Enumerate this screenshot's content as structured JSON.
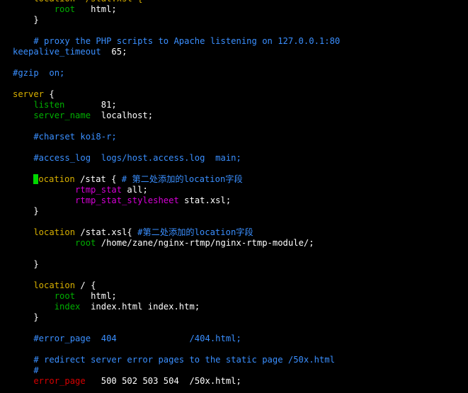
{
  "terminal": {
    "background": "#000000",
    "default_color": "#ffffff",
    "cursor_color": "#00d700",
    "lines": [
      {
        "segments": [
          {
            "text": "    location  /stat.xsl {",
            "color": "#d7af00"
          }
        ]
      },
      {
        "segments": [
          {
            "text": "        root",
            "color": "#00af00"
          },
          {
            "text": "   html;",
            "color": "#ffffff"
          }
        ]
      },
      {
        "segments": [
          {
            "text": "    }",
            "color": "#ffffff"
          }
        ]
      },
      {
        "segments": []
      },
      {
        "segments": [
          {
            "text": "    # proxy the PHP scripts to Apache listening on 127.0.0.1:80",
            "color": "#3a8fff"
          }
        ]
      },
      {
        "segments": [
          {
            "text": "keepalive_timeout",
            "color": "#3a8fff"
          },
          {
            "text": "  65;",
            "color": "#ffffff"
          }
        ]
      },
      {
        "segments": []
      },
      {
        "segments": [
          {
            "text": "#gzip  on;",
            "color": "#3a8fff"
          }
        ]
      },
      {
        "segments": []
      },
      {
        "segments": [
          {
            "text": "server",
            "color": "#d7af00"
          },
          {
            "text": " {",
            "color": "#ffffff"
          }
        ]
      },
      {
        "segments": [
          {
            "text": "    listen",
            "color": "#00af00"
          },
          {
            "text": "       81;",
            "color": "#ffffff"
          }
        ]
      },
      {
        "segments": [
          {
            "text": "    server_name",
            "color": "#00af00"
          },
          {
            "text": "  localhost;",
            "color": "#ffffff"
          }
        ]
      },
      {
        "segments": []
      },
      {
        "segments": [
          {
            "text": "    #charset koi8-r;",
            "color": "#3a8fff"
          }
        ]
      },
      {
        "segments": []
      },
      {
        "segments": [
          {
            "text": "    #access_log  logs/host.access.log  main;",
            "color": "#3a8fff"
          }
        ]
      },
      {
        "segments": []
      },
      {
        "segments": [
          {
            "text": "    ",
            "color": "#ffffff"
          },
          {
            "text": "location",
            "color": "#d7af00",
            "cursor": true
          },
          {
            "text": " /stat { ",
            "color": "#ffffff"
          },
          {
            "text": "# 第二处添加的location字段",
            "color": "#3a8fff"
          }
        ]
      },
      {
        "segments": [
          {
            "text": "            rtmp_stat",
            "color": "#d700d7"
          },
          {
            "text": " all;",
            "color": "#ffffff"
          }
        ]
      },
      {
        "segments": [
          {
            "text": "            rtmp_stat_stylesheet",
            "color": "#d700d7"
          },
          {
            "text": " stat.xsl;",
            "color": "#ffffff"
          }
        ]
      },
      {
        "segments": [
          {
            "text": "    }",
            "color": "#ffffff"
          }
        ]
      },
      {
        "segments": []
      },
      {
        "segments": [
          {
            "text": "    location",
            "color": "#d7af00"
          },
          {
            "text": " /stat.xsl{ ",
            "color": "#ffffff"
          },
          {
            "text": "#第二处添加的location字段",
            "color": "#3a8fff"
          }
        ]
      },
      {
        "segments": [
          {
            "text": "            root",
            "color": "#00af00"
          },
          {
            "text": " /home/zane/nginx-rtmp/nginx-rtmp-module/;",
            "color": "#ffffff"
          }
        ]
      },
      {
        "segments": []
      },
      {
        "segments": [
          {
            "text": "    }",
            "color": "#ffffff"
          }
        ]
      },
      {
        "segments": []
      },
      {
        "segments": [
          {
            "text": "    location",
            "color": "#d7af00"
          },
          {
            "text": " / {",
            "color": "#ffffff"
          }
        ]
      },
      {
        "segments": [
          {
            "text": "        root",
            "color": "#00af00"
          },
          {
            "text": "   html;",
            "color": "#ffffff"
          }
        ]
      },
      {
        "segments": [
          {
            "text": "        index",
            "color": "#00af00"
          },
          {
            "text": "  index.html index.htm;",
            "color": "#ffffff"
          }
        ]
      },
      {
        "segments": [
          {
            "text": "    }",
            "color": "#ffffff"
          }
        ]
      },
      {
        "segments": []
      },
      {
        "segments": [
          {
            "text": "    #error_page  404              /404.html;",
            "color": "#3a8fff"
          }
        ]
      },
      {
        "segments": []
      },
      {
        "segments": [
          {
            "text": "    # redirect server error pages to the static page /50x.html",
            "color": "#3a8fff"
          }
        ]
      },
      {
        "segments": [
          {
            "text": "    #",
            "color": "#3a8fff"
          }
        ]
      },
      {
        "segments": [
          {
            "text": "    error_page",
            "color": "#d70000"
          },
          {
            "text": "   500 502 503 504  /50x.html;",
            "color": "#ffffff"
          }
        ]
      }
    ]
  }
}
